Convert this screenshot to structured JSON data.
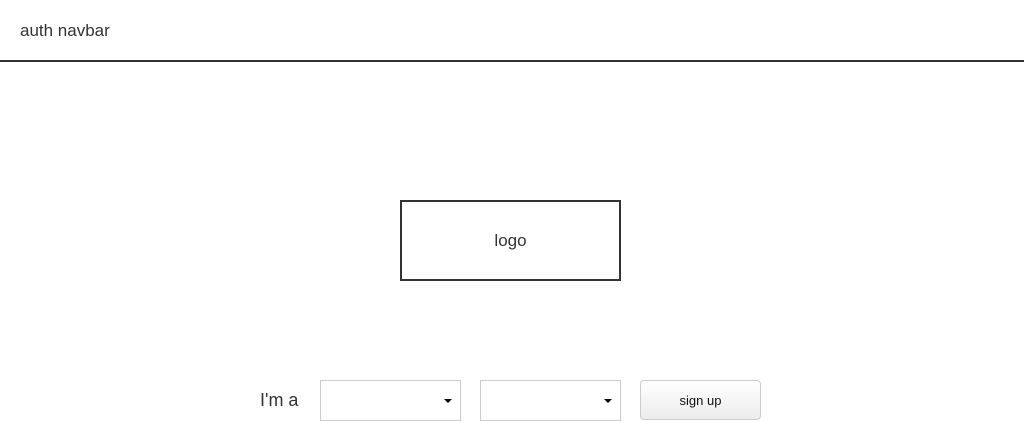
{
  "navbar": {
    "brand": "auth navbar"
  },
  "logo": {
    "label": "logo"
  },
  "form": {
    "role_label": "I'm a",
    "select_1_value": "",
    "select_2_value": "",
    "signup_label": "sign up"
  }
}
